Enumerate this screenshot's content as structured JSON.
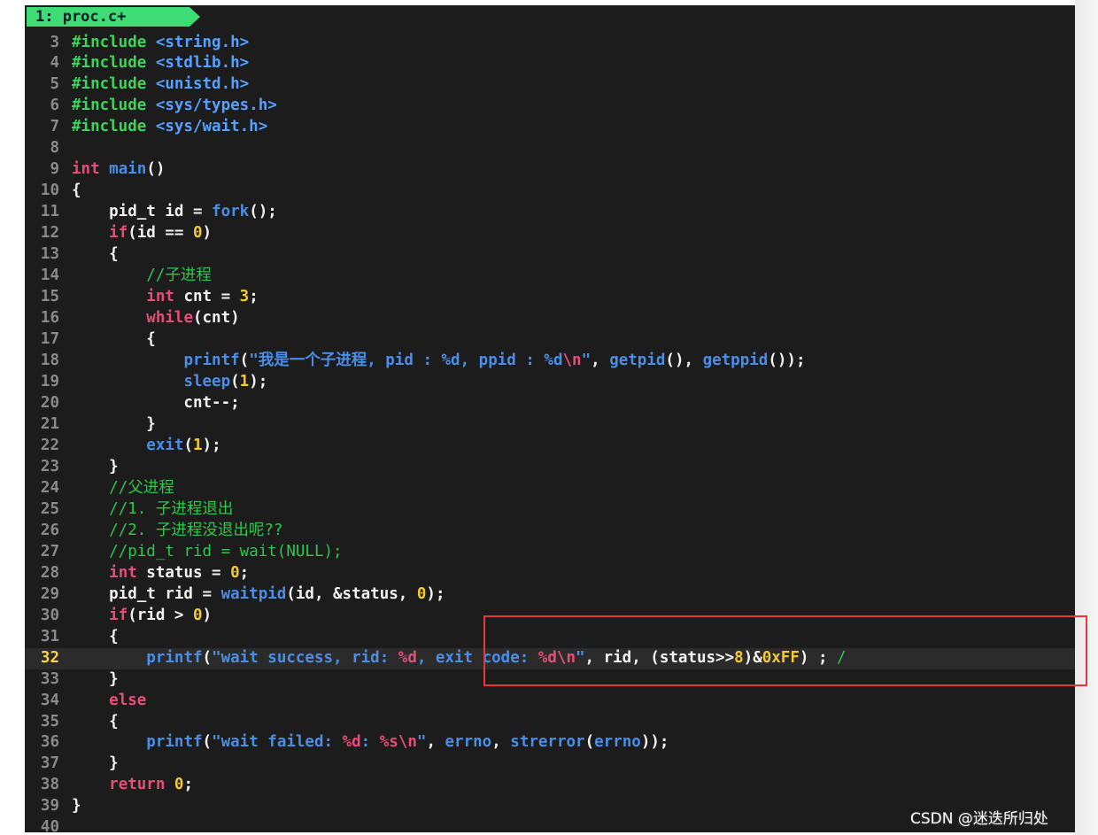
{
  "tab": {
    "label": "1: proc.c+"
  },
  "watermark": "CSDN @迷迭所归处",
  "colors": {
    "tab_bg": "#3ddc74",
    "keyword": "#e94c78",
    "function": "#4a8ee8",
    "preprocessor": "#3fd35a",
    "number": "#f5c933",
    "comment": "#2ec84a",
    "highlight_box": "#e53935"
  },
  "current_line": 32,
  "lines": [
    {
      "n": "3",
      "tokens": [
        [
          "pre",
          "#include "
        ],
        [
          "inc",
          "<string.h>"
        ]
      ]
    },
    {
      "n": "4",
      "tokens": [
        [
          "pre",
          "#include "
        ],
        [
          "inc",
          "<stdlib.h>"
        ]
      ]
    },
    {
      "n": "5",
      "tokens": [
        [
          "pre",
          "#include "
        ],
        [
          "inc",
          "<unistd.h>"
        ]
      ]
    },
    {
      "n": "6",
      "tokens": [
        [
          "pre",
          "#include "
        ],
        [
          "inc",
          "<sys/types.h>"
        ]
      ]
    },
    {
      "n": "7",
      "tokens": [
        [
          "pre",
          "#include "
        ],
        [
          "inc",
          "<sys/wait.h>"
        ]
      ]
    },
    {
      "n": "8",
      "tokens": []
    },
    {
      "n": "9",
      "tokens": [
        [
          "kw",
          "int"
        ],
        [
          "txt",
          " "
        ],
        [
          "fn",
          "main"
        ],
        [
          "txt",
          "()"
        ]
      ]
    },
    {
      "n": "10",
      "tokens": [
        [
          "txt",
          "{"
        ]
      ]
    },
    {
      "n": "11",
      "tokens": [
        [
          "txt",
          "    pid_t id = "
        ],
        [
          "fn",
          "fork"
        ],
        [
          "txt",
          "();"
        ]
      ]
    },
    {
      "n": "12",
      "tokens": [
        [
          "txt",
          "    "
        ],
        [
          "kw",
          "if"
        ],
        [
          "txt",
          "(id == "
        ],
        [
          "num",
          "0"
        ],
        [
          "txt",
          ")"
        ]
      ]
    },
    {
      "n": "13",
      "tokens": [
        [
          "txt",
          "    {"
        ]
      ]
    },
    {
      "n": "14",
      "tokens": [
        [
          "txt",
          "        "
        ],
        [
          "cm",
          "//子进程"
        ]
      ]
    },
    {
      "n": "15",
      "tokens": [
        [
          "txt",
          "        "
        ],
        [
          "kw",
          "int"
        ],
        [
          "txt",
          " cnt = "
        ],
        [
          "num",
          "3"
        ],
        [
          "txt",
          ";"
        ]
      ]
    },
    {
      "n": "16",
      "tokens": [
        [
          "txt",
          "        "
        ],
        [
          "kw",
          "while"
        ],
        [
          "txt",
          "(cnt)"
        ]
      ]
    },
    {
      "n": "17",
      "tokens": [
        [
          "txt",
          "        {"
        ]
      ]
    },
    {
      "n": "18",
      "tokens": [
        [
          "txt",
          "            "
        ],
        [
          "fn",
          "printf"
        ],
        [
          "txt",
          "("
        ],
        [
          "str",
          "\"我是一个子进程, pid : %d, ppid : %d"
        ],
        [
          "esc",
          "\\n"
        ],
        [
          "str",
          "\""
        ],
        [
          "txt",
          ", "
        ],
        [
          "fn",
          "getpid"
        ],
        [
          "txt",
          "(), "
        ],
        [
          "fn",
          "getppid"
        ],
        [
          "txt",
          "());"
        ]
      ]
    },
    {
      "n": "19",
      "tokens": [
        [
          "txt",
          "            "
        ],
        [
          "fn",
          "sleep"
        ],
        [
          "txt",
          "("
        ],
        [
          "num",
          "1"
        ],
        [
          "txt",
          ");"
        ]
      ]
    },
    {
      "n": "20",
      "tokens": [
        [
          "txt",
          "            cnt--;"
        ]
      ]
    },
    {
      "n": "21",
      "tokens": [
        [
          "txt",
          "        }"
        ]
      ]
    },
    {
      "n": "22",
      "tokens": [
        [
          "txt",
          "        "
        ],
        [
          "fn",
          "exit"
        ],
        [
          "txt",
          "("
        ],
        [
          "num",
          "1"
        ],
        [
          "txt",
          ");"
        ]
      ]
    },
    {
      "n": "23",
      "tokens": [
        [
          "txt",
          "    }"
        ]
      ]
    },
    {
      "n": "24",
      "tokens": [
        [
          "txt",
          "    "
        ],
        [
          "cm",
          "//父进程"
        ]
      ]
    },
    {
      "n": "25",
      "tokens": [
        [
          "txt",
          "    "
        ],
        [
          "cm",
          "//1. 子进程退出"
        ]
      ]
    },
    {
      "n": "26",
      "tokens": [
        [
          "txt",
          "    "
        ],
        [
          "cm",
          "//2. 子进程没退出呢??"
        ]
      ]
    },
    {
      "n": "27",
      "tokens": [
        [
          "txt",
          "    "
        ],
        [
          "cm",
          "//pid_t rid = wait(NULL);"
        ]
      ]
    },
    {
      "n": "28",
      "tokens": [
        [
          "txt",
          "    "
        ],
        [
          "kw",
          "int"
        ],
        [
          "txt",
          " status = "
        ],
        [
          "num",
          "0"
        ],
        [
          "txt",
          ";"
        ]
      ]
    },
    {
      "n": "29",
      "tokens": [
        [
          "txt",
          "    pid_t rid = "
        ],
        [
          "fn",
          "waitpid"
        ],
        [
          "txt",
          "(id, &status, "
        ],
        [
          "num",
          "0"
        ],
        [
          "txt",
          ");"
        ]
      ]
    },
    {
      "n": "30",
      "tokens": [
        [
          "txt",
          "    "
        ],
        [
          "kw",
          "if"
        ],
        [
          "txt",
          "(rid > "
        ],
        [
          "num",
          "0"
        ],
        [
          "txt",
          ")"
        ]
      ]
    },
    {
      "n": "31",
      "tokens": [
        [
          "txt",
          "    {"
        ]
      ]
    },
    {
      "n": "32",
      "tokens": [
        [
          "txt",
          "        "
        ],
        [
          "fn",
          "printf"
        ],
        [
          "txt",
          "("
        ],
        [
          "str",
          "\"wait success, rid: "
        ],
        [
          "esc",
          "%d"
        ],
        [
          "str",
          ", exit code: "
        ],
        [
          "esc",
          "%d"
        ],
        [
          "esc",
          "\\n"
        ],
        [
          "str",
          "\""
        ],
        [
          "txt",
          ", rid, (status>>"
        ],
        [
          "num",
          "8"
        ],
        [
          "txt",
          ")&"
        ],
        [
          "num",
          "0xFF"
        ],
        [
          "txt",
          ") ; "
        ],
        [
          "cm",
          "/"
        ]
      ]
    },
    {
      "n": "33",
      "tokens": [
        [
          "txt",
          "    }"
        ]
      ]
    },
    {
      "n": "34",
      "tokens": [
        [
          "txt",
          "    "
        ],
        [
          "kw",
          "else"
        ]
      ]
    },
    {
      "n": "35",
      "tokens": [
        [
          "txt",
          "    {"
        ]
      ]
    },
    {
      "n": "36",
      "tokens": [
        [
          "txt",
          "        "
        ],
        [
          "fn",
          "printf"
        ],
        [
          "txt",
          "("
        ],
        [
          "str",
          "\"wait failed: "
        ],
        [
          "esc",
          "%d"
        ],
        [
          "str",
          ": "
        ],
        [
          "esc",
          "%s"
        ],
        [
          "esc",
          "\\n"
        ],
        [
          "str",
          "\""
        ],
        [
          "txt",
          ", "
        ],
        [
          "fn",
          "errno"
        ],
        [
          "txt",
          ", "
        ],
        [
          "fn",
          "strerror"
        ],
        [
          "txt",
          "("
        ],
        [
          "fn",
          "errno"
        ],
        [
          "txt",
          "));"
        ]
      ]
    },
    {
      "n": "37",
      "tokens": [
        [
          "txt",
          "    }"
        ]
      ]
    },
    {
      "n": "38",
      "tokens": [
        [
          "txt",
          "    "
        ],
        [
          "kw",
          "return"
        ],
        [
          "txt",
          " "
        ],
        [
          "num",
          "0"
        ],
        [
          "txt",
          ";"
        ]
      ]
    },
    {
      "n": "39",
      "tokens": [
        [
          "txt",
          "}"
        ]
      ]
    },
    {
      "n": "40",
      "tokens": []
    }
  ]
}
